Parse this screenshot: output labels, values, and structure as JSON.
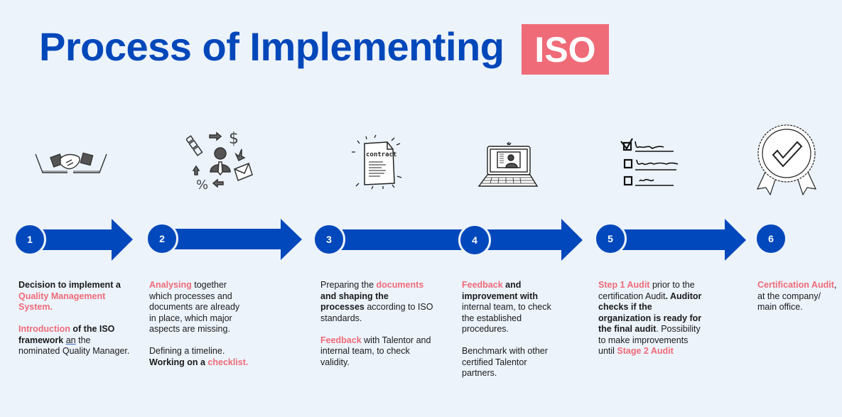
{
  "title": {
    "text": "Process of Implementing",
    "badge": "ISO"
  },
  "colors": {
    "primary": "#0047BA",
    "accent": "#EF6B78",
    "background": "#ECF3FB"
  },
  "steps": [
    {
      "number": "1",
      "icon": "handshake-laptops-icon",
      "paragraphs": [
        [
          {
            "t": "Decision to implement a ",
            "s": "b"
          },
          {
            "t": "Quality Management System.",
            "s": "hl"
          }
        ],
        [
          {
            "t": "Introduction",
            "s": "hl"
          },
          {
            "t": " of the ISO framework",
            "s": "b"
          },
          {
            "t": " "
          },
          {
            "t": "an",
            "s": "ul"
          },
          {
            "t": " the nominated Quality Manager."
          }
        ]
      ]
    },
    {
      "number": "2",
      "icon": "business-analysis-icon",
      "paragraphs": [
        [
          {
            "t": "Analysing",
            "s": "hl"
          },
          {
            "t": " together which processes and documents are already in place, which major aspects are missing."
          }
        ],
        [
          {
            "t": "Defining a timeline. "
          },
          {
            "t": "Working on a ",
            "s": "b"
          },
          {
            "t": "checklist.",
            "s": "hl"
          }
        ]
      ]
    },
    {
      "number": "3",
      "icon": "contract-document-icon",
      "paragraphs": [
        [
          {
            "t": "Preparing the "
          },
          {
            "t": "documents",
            "s": "hl"
          },
          {
            "t": " and shaping the processes",
            "s": "b"
          },
          {
            "t": " according to ISO standards."
          }
        ],
        [
          {
            "t": "Feedback",
            "s": "hl"
          },
          {
            "t": " with Talentor and internal team, to check validity."
          }
        ]
      ]
    },
    {
      "number": "4",
      "icon": "video-call-laptop-icon",
      "paragraphs": [
        [
          {
            "t": "Feedback",
            "s": "hl"
          },
          {
            "t": " and improvement with",
            "s": "b"
          },
          {
            "t": " internal team, to check the established procedures."
          }
        ],
        [
          {
            "t": "Benchmark with other certified Talentor partners."
          }
        ]
      ]
    },
    {
      "number": "5",
      "icon": "checklist-icon",
      "paragraphs": [
        [
          {
            "t": "Step 1 Audit",
            "s": "hl"
          },
          {
            "t": " prior to the certification Audit"
          },
          {
            "t": ". Auditor checks if the organization is ready for the final audit",
            "s": "b"
          },
          {
            "t": ". Possibility to make improvements until "
          },
          {
            "t": "Stage 2 Audit",
            "s": "hl"
          }
        ]
      ]
    },
    {
      "number": "6",
      "icon": "certificate-badge-icon",
      "paragraphs": [
        [
          {
            "t": "Certification Audit",
            "s": "hl"
          },
          {
            "t": ", at the company/ main office."
          }
        ]
      ]
    }
  ]
}
